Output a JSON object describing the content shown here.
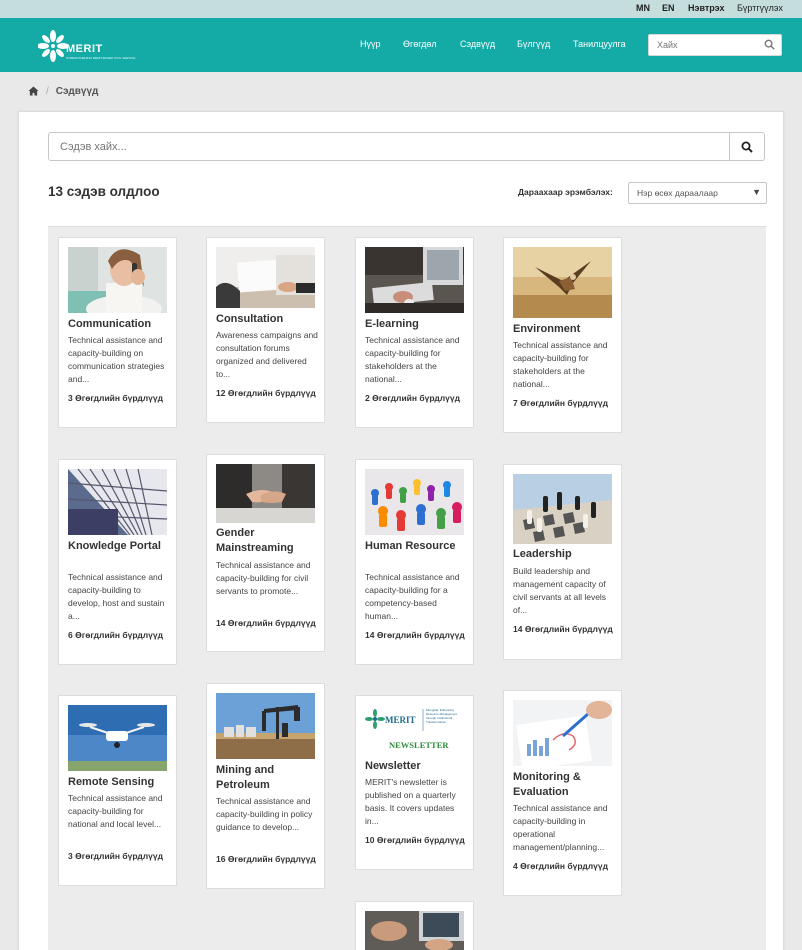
{
  "topbar": {
    "lang_mn": "MN",
    "lang_en": "EN",
    "login": "Нэвтрэх",
    "register": "Бүртгүүлэх"
  },
  "brand": {
    "name": "MERIT",
    "tagline": "STRENGTHENING MERIT-BASED CIVIL SERVICE",
    "color": "#14aaa6"
  },
  "nav": {
    "items": [
      "Нүүр",
      "Өгөгдөл",
      "Сэдвүүд",
      "Бүлгүүд",
      "Танилцуулга"
    ],
    "search_placeholder": "Хайх"
  },
  "breadcrumb": {
    "home_icon": "home-icon",
    "current": "Сэдвүүд"
  },
  "search": {
    "placeholder": "Сэдэв хайх..."
  },
  "results": {
    "count_text": "13 сэдэв олдлоо",
    "sort_label": "Дараахаар эрэмбэлэх:",
    "sort_value": "Нэр өсөх дараалаар"
  },
  "cards": [
    {
      "title": "Communication",
      "desc": "Technical assistance and capacity-building on communication strategies and...",
      "count": "3 Өгөгдлийн бүрдлүүд"
    },
    {
      "title": "Consultation",
      "desc": "Awareness campaigns and consultation forums organized and delivered to...",
      "count": "12 Өгөгдлийн бүрдлүүд"
    },
    {
      "title": "E-learning",
      "desc": "Technical assistance and capacity-building for stakeholders at the national...",
      "count": "2 Өгөгдлийн бүрдлүүд"
    },
    {
      "title": "Environment",
      "desc": "Technical assistance and capacity-building for stakeholders at the national...",
      "count": "7 Өгөгдлийн бүрдлүүд"
    },
    {
      "title": "Knowledge Portal",
      "desc": "Technical assistance and capacity-building to develop, host and sustain a...",
      "count": "6 Өгөгдлийн бүрдлүүд"
    },
    {
      "title": "Gender Mainstreaming",
      "desc": "Technical assistance and capacity-building for civil servants to promote...",
      "count": "14 Өгөгдлийн бүрдлүүд"
    },
    {
      "title": "Human Resource",
      "desc": "Technical assistance and capacity-building for a competency-based human...",
      "count": "14 Өгөгдлийн бүрдлүүд"
    },
    {
      "title": "Leadership",
      "desc": "Build leadership and management capacity of civil servants at all levels of...",
      "count": "14 Өгөгдлийн бүрдлүүд"
    },
    {
      "title": "Remote Sensing",
      "desc": "Technical assistance and capacity-building for national and local level...",
      "count": "3 Өгөгдлийн бүрдлүүд"
    },
    {
      "title": "Mining and Petroleum",
      "desc": "Technical assistance and capacity-building in policy guidance to develop...",
      "count": "16 Өгөгдлийн бүрдлүүд"
    },
    {
      "title": "Newsletter",
      "desc": "MERIT's newsletter is published on a quarterly basis. It covers updates in...",
      "count": "10 Өгөгдлийн бүрдлүүд"
    },
    {
      "title": "Monitoring & Evaluation",
      "desc": "Technical assistance and capacity-building in operational management/planning...",
      "count": "4 Өгөгдлийн бүрдлүүд"
    },
    {
      "title": "",
      "desc": "",
      "count": ""
    }
  ],
  "newsletter_thumb": {
    "logo": "MERIT",
    "caption": "NEWSLETTER",
    "side_text": "Mongolia: Enhancing Resource Management through Institutional Transformation"
  }
}
